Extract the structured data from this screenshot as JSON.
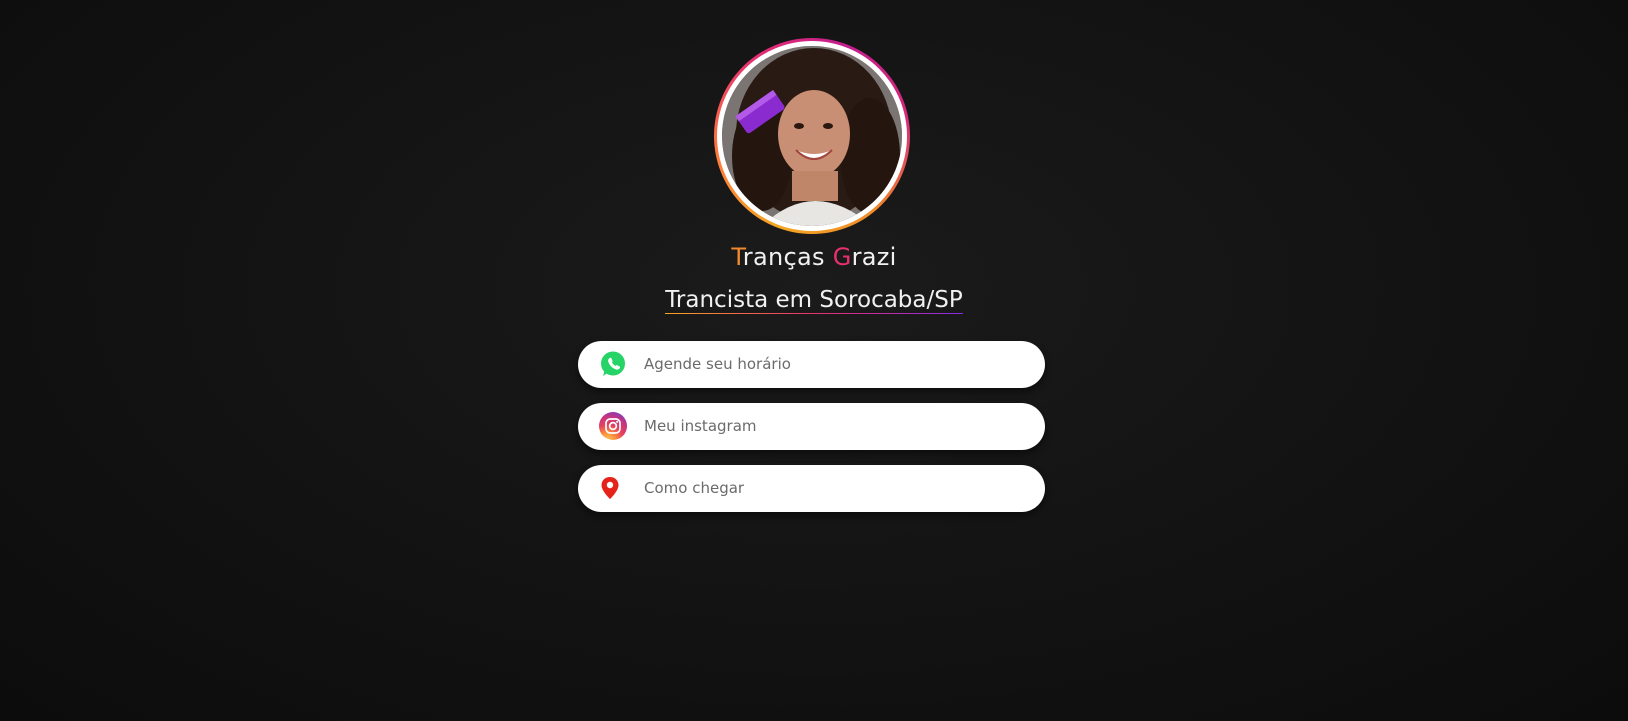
{
  "profile": {
    "name_first_initial": "T",
    "name_first_rest": "ranças ",
    "name_second_initial": "G",
    "name_second_rest": "razi",
    "subtitle": "Trancista em Sorocaba/SP",
    "avatar": "profile-photo"
  },
  "links": [
    {
      "label": "Agende seu horário",
      "icon": "whatsapp-icon"
    },
    {
      "label": "Meu instagram",
      "icon": "instagram-icon"
    },
    {
      "label": "Como chegar",
      "icon": "location-pin-icon"
    }
  ],
  "colors": {
    "background": "#141414",
    "accent_orange": "#f0892f",
    "accent_pink": "#e8306f",
    "whatsapp_green": "#25d366",
    "pin_red": "#e5231b",
    "button_bg": "#ffffff",
    "button_text": "#6b6b6b"
  }
}
